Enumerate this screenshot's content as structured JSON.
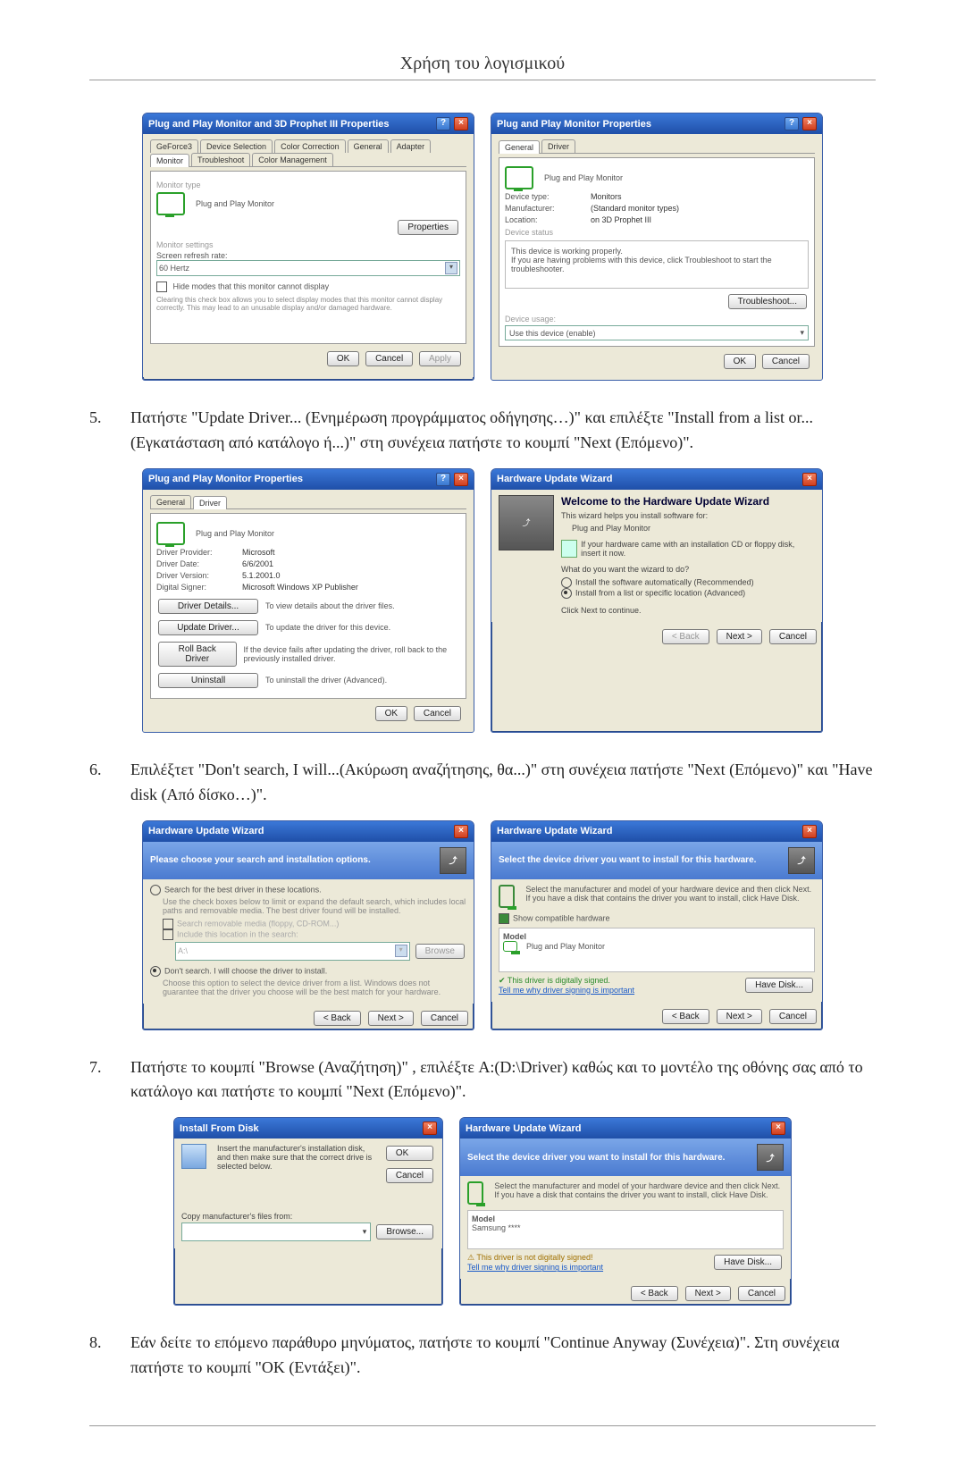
{
  "page": {
    "title": "Χρήση του λογισμικού"
  },
  "step5": {
    "num": "5.",
    "text": "Πατήστε \"Update Driver... (Ενημέρωση προγράμματος οδήγησης…)\" και επιλέξτε \"Install from a list or...(Εγκατάσταση από κατάλογο ή...)\" στη συνέχεια πατήστε το κουμπί \"Next (Επόμενο)\"."
  },
  "step6": {
    "num": "6.",
    "text": "Επιλέξτετ \"Don't search, I will...(Ακύρωση αναζήτησης, θα...)\" στη συνέχεια πατήστε \"Next (Επόμενο)\" και \"Have disk (Από δίσκο…)\"."
  },
  "step7": {
    "num": "7.",
    "text": "Πατήστε το κουμπί \"Browse (Αναζήτηση)\" , επιλέξτε A:(D:\\Driver) καθώς και το μοντέλο της οθόνης σας από το κατάλογο και πατήστε το κουμπί \"Next (Επόμενο)\"."
  },
  "step8": {
    "num": "8.",
    "text": "Εάν δείτε το επόμενο παράθυρο μηνύματος, πατήστε το κουμπί \"Continue Anyway (Συνέχεια)\". Στη συνέχεια πατήστε το κουμπί \"OK (Εντάξει)\"."
  },
  "dlg_prop1": {
    "title": "Plug and Play Monitor and 3D Prophet III Properties",
    "tabs": [
      "GeForce3",
      "Device Selection",
      "Color Correction",
      "General",
      "Adapter",
      "Monitor",
      "Troubleshoot",
      "Color Management"
    ],
    "active_tab": "Monitor",
    "grp1": "Monitor type",
    "mon_name": "Plug and Play Monitor",
    "btn_prop": "Properties",
    "grp2": "Monitor settings",
    "lbl_refresh": "Screen refresh rate:",
    "refresh_val": "60 Hertz",
    "chk_hide": "Hide modes that this monitor cannot display",
    "hide_desc": "Clearing this check box allows you to select display modes that this monitor cannot display correctly. This may lead to an unusable display and/or damaged hardware.",
    "ok": "OK",
    "cancel": "Cancel",
    "apply": "Apply"
  },
  "dlg_mon": {
    "title": "Plug and Play Monitor Properties",
    "tabs": [
      "General",
      "Driver"
    ],
    "active_tab": "General",
    "mon_name": "Plug and Play Monitor",
    "dev_type_l": "Device type:",
    "dev_type_v": "Monitors",
    "manu_l": "Manufacturer:",
    "manu_v": "(Standard monitor types)",
    "loc_l": "Location:",
    "loc_v": "on 3D Prophet III",
    "grp_status": "Device status",
    "status1": "This device is working properly.",
    "status2": "If you are having problems with this device, click Troubleshoot to start the troubleshooter.",
    "btn_ts": "Troubleshoot...",
    "grp_usage": "Device usage:",
    "usage_v": "Use this device (enable)",
    "ok": "OK",
    "cancel": "Cancel"
  },
  "dlg_driver": {
    "title": "Plug and Play Monitor Properties",
    "tabs": [
      "General",
      "Driver"
    ],
    "mon_name": "Plug and Play Monitor",
    "rows": [
      [
        "Driver Provider:",
        "Microsoft"
      ],
      [
        "Driver Date:",
        "6/6/2001"
      ],
      [
        "Driver Version:",
        "5.1.2001.0"
      ],
      [
        "Digital Signer:",
        "Microsoft Windows XP Publisher"
      ]
    ],
    "btn_details": "Driver Details...",
    "txt_details": "To view details about the driver files.",
    "btn_update": "Update Driver...",
    "txt_update": "To update the driver for this device.",
    "btn_roll": "Roll Back Driver",
    "txt_roll": "If the device fails after updating the driver, roll back to the previously installed driver.",
    "btn_uninst": "Uninstall",
    "txt_uninst": "To uninstall the driver (Advanced).",
    "ok": "OK",
    "cancel": "Cancel"
  },
  "wiz1": {
    "title": "Hardware Update Wizard",
    "h": "Welcome to the Hardware Update Wizard",
    "sub": "This wizard helps you install software for:",
    "dev": "Plug and Play Monitor",
    "cd": "If your hardware came with an installation CD or floppy disk, insert it now.",
    "q": "What do you want the wizard to do?",
    "opt1": "Install the software automatically (Recommended)",
    "opt2": "Install from a list or specific location (Advanced)",
    "cont": "Click Next to continue.",
    "back": "< Back",
    "next": "Next >",
    "cancel": "Cancel"
  },
  "wiz2a": {
    "title": "Hardware Update Wizard",
    "head": "Please choose your search and installation options.",
    "opt1": "Search for the best driver in these locations.",
    "opt1d": "Use the check boxes below to limit or expand the default search, which includes local paths and removable media. The best driver found will be installed.",
    "chk1": "Search removable media (floppy, CD-ROM...)",
    "chk2": "Include this location in the search:",
    "loc": "A:\\",
    "browse": "Browse",
    "opt2": "Don't search. I will choose the driver to install.",
    "opt2d": "Choose this option to select the device driver from a list. Windows does not guarantee that the driver you choose will be the best match for your hardware.",
    "back": "< Back",
    "next": "Next >",
    "cancel": "Cancel"
  },
  "wiz2b": {
    "title": "Hardware Update Wizard",
    "head": "Select the device driver you want to install for this hardware.",
    "sel": "Select the manufacturer and model of your hardware device and then click Next. If you have a disk that contains the driver you want to install, click Have Disk.",
    "chk": "Show compatible hardware",
    "model_h": "Model",
    "model_v": "Plug and Play Monitor",
    "sign": "This driver is digitally signed.",
    "why": "Tell me why driver signing is important",
    "have": "Have Disk...",
    "back": "< Back",
    "next": "Next >",
    "cancel": "Cancel"
  },
  "install_disk": {
    "title": "Install From Disk",
    "msg": "Insert the manufacturer's installation disk, and then make sure that the correct drive is selected below.",
    "ok": "OK",
    "cancel": "Cancel",
    "copy": "Copy manufacturer's files from:",
    "browse": "Browse..."
  },
  "wiz3": {
    "title": "Hardware Update Wizard",
    "head": "Select the device driver you want to install for this hardware.",
    "sel": "Select the manufacturer and model of your hardware device and then click Next. If you have a disk that contains the driver you want to install, click Have Disk.",
    "model_h": "Model",
    "model_v": "Samsung ****",
    "warn": "This driver is not digitally signed!",
    "why": "Tell me why driver signing is important",
    "have": "Have Disk...",
    "back": "< Back",
    "next": "Next >",
    "cancel": "Cancel"
  }
}
